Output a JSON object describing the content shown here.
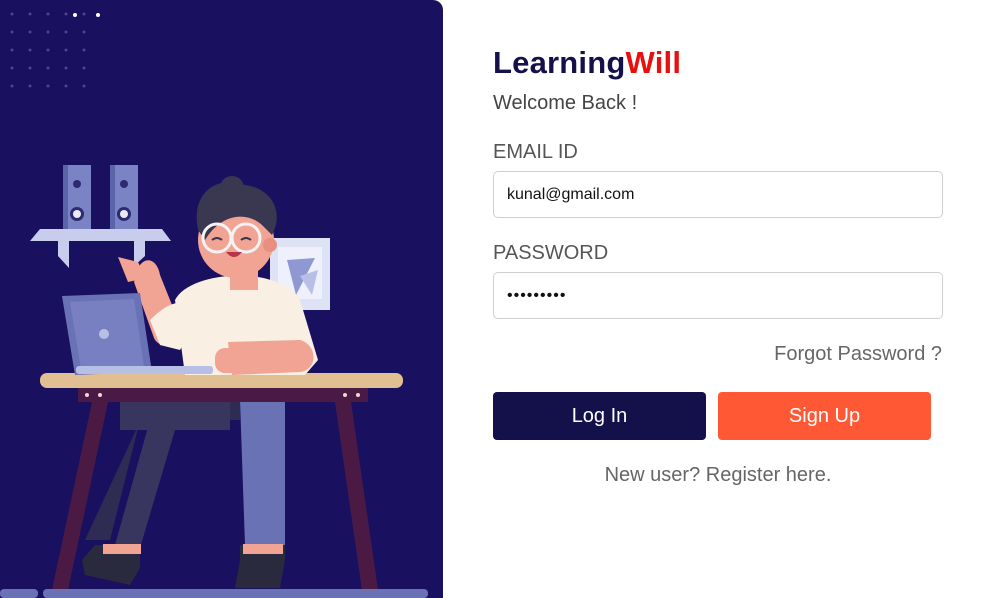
{
  "brand": {
    "part1": "Learning",
    "part2": "Will"
  },
  "welcome": "Welcome Back !",
  "form": {
    "email_label": "EMAIL ID",
    "email_value": "kunal@gmail.com",
    "password_label": "PASSWORD",
    "password_value": "123456789",
    "forgot_label": "Forgot Password ?",
    "login_label": "Log In",
    "signup_label": "Sign Up"
  },
  "register": {
    "prefix": "New user? ",
    "link": "Register here."
  },
  "colors": {
    "left_panel_bg": "#1a1060",
    "brand_dark": "#14104a",
    "brand_red": "#e8100d",
    "login_button": "#14104a",
    "signup_button": "#fe5934"
  },
  "illustration": {
    "name": "person-at-laptop-illustration"
  }
}
